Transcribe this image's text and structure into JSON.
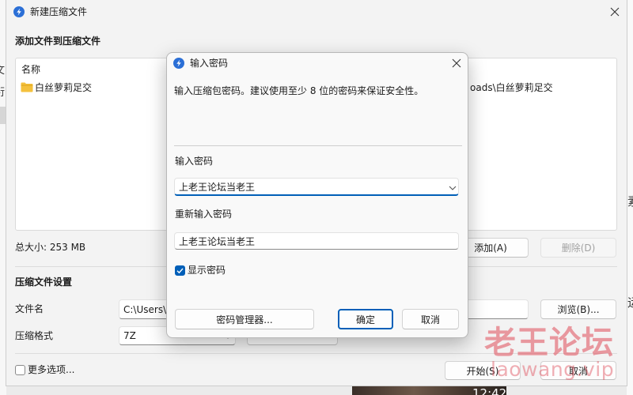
{
  "main_window": {
    "title": "新建压缩文件",
    "add_files_section": "添加文件到压缩文件",
    "file_list": {
      "columns": [
        "名称"
      ],
      "rows": [
        {
          "name": "白丝萝莉足交",
          "path": "oads\\白丝萝莉足交",
          "icon": "folder-icon"
        }
      ]
    },
    "total_size": "总大小: 253 MB",
    "add_button": "添加(A)",
    "delete_button": "删除(D)",
    "delete_enabled": false,
    "settings_section": "压缩文件设置",
    "filename_label": "文件名",
    "filename_value": "C:\\Users\\",
    "browse_button": "浏览(B)...",
    "format_label": "压缩格式",
    "format_value": "7Z",
    "more_options_label": "更多选项...",
    "more_options_checked": false,
    "start_button": "开始(S)",
    "cancel_button": "取消"
  },
  "password_dialog": {
    "title": "输入密码",
    "message": "输入压缩包密码。建议使用至少 8 位的密码来保证安全性。",
    "password_label": "输入密码",
    "password_value": "上老王论坛当老王",
    "confirm_label": "重新输入密码",
    "confirm_value": "上老王论坛当老王",
    "show_password_label": "显示密码",
    "show_password_checked": true,
    "manager_button": "密码管理器...",
    "ok_button": "确定",
    "cancel_button": "取消"
  },
  "watermark": {
    "title": "老王论坛",
    "url": "laowang.vip"
  },
  "background": {
    "left_text": [
      "文",
      "衍"
    ],
    "right_text": [
      "素",
      "运"
    ],
    "clock": "12:42"
  },
  "icons": {
    "app": "bandizip-app-icon",
    "close": "close-icon",
    "folder": "folder-icon",
    "dropdown": "chevron-down-icon",
    "checkbox": "checkbox-icon"
  },
  "colors": {
    "accent": "#005fb8",
    "window_bg": "#f3f3f3",
    "app_icon": "#2b6fd6",
    "folder": "#f4c13d",
    "watermark": "#e2606b"
  }
}
